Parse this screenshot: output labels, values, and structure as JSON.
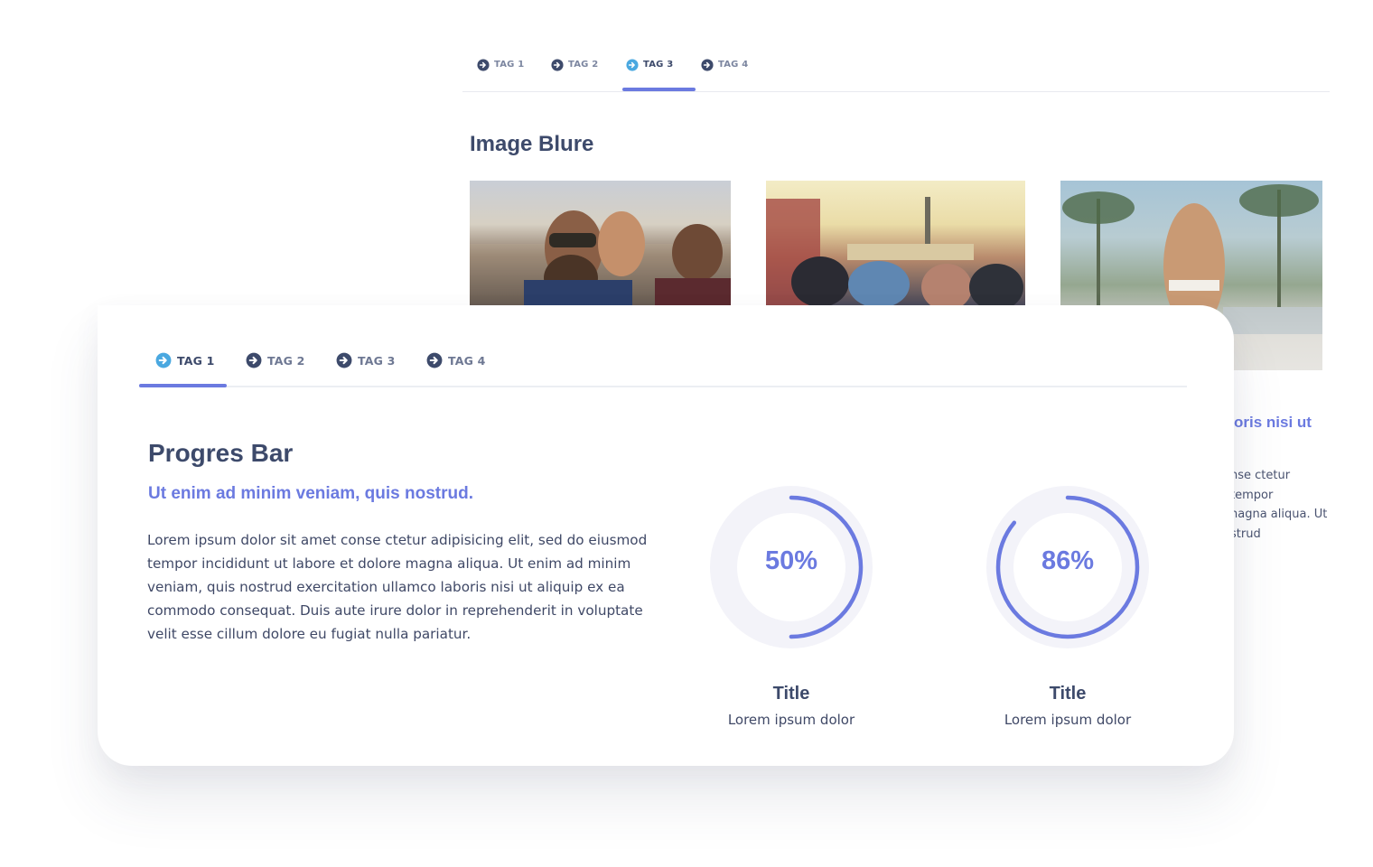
{
  "back_panel": {
    "tabs": [
      {
        "label": "TAG 1"
      },
      {
        "label": "TAG 2"
      },
      {
        "label": "TAG 3"
      },
      {
        "label": "TAG 4"
      }
    ],
    "active_tab": "TAG 3",
    "heading": "Image Blure",
    "subtitle_partial": "oris nisi ut",
    "body_partial": [
      "nse ctetur",
      "tempor",
      "nagna aliqua. Ut",
      "strud"
    ]
  },
  "front_panel": {
    "tabs": [
      {
        "label": "TAG 1"
      },
      {
        "label": "TAG 2"
      },
      {
        "label": "TAG 3"
      },
      {
        "label": "TAG 4"
      }
    ],
    "active_tab": "TAG 1",
    "title": "Progres Bar",
    "subtitle": "Ut enim ad minim veniam, quis nostrud.",
    "paragraph": "Lorem ipsum dolor sit amet conse ctetur adipisicing elit, sed do eiusmod tempor incididunt ut labore et dolore magna aliqua. Ut enim ad minim veniam, quis nostrud exercitation ullamco laboris nisi ut aliquip ex ea commodo consequat. Duis aute irure dolor in reprehenderit in voluptate velit esse cillum dolore eu fugiat nulla pariatur.",
    "progress": [
      {
        "value_text": "50%",
        "percent": 50,
        "title": "Title",
        "caption": "Lorem ipsum dolor"
      },
      {
        "value_text": "86%",
        "percent": 86,
        "title": "Title",
        "caption": "Lorem ipsum dolor"
      }
    ]
  },
  "colors": {
    "accent": "#6b7ae0",
    "text_dark": "#3d4a6b",
    "tab_icon_active": "#4aa8e0",
    "ring_track": "#f3f3f9"
  },
  "icons": {
    "tab": "arrow-circle-right-icon"
  }
}
